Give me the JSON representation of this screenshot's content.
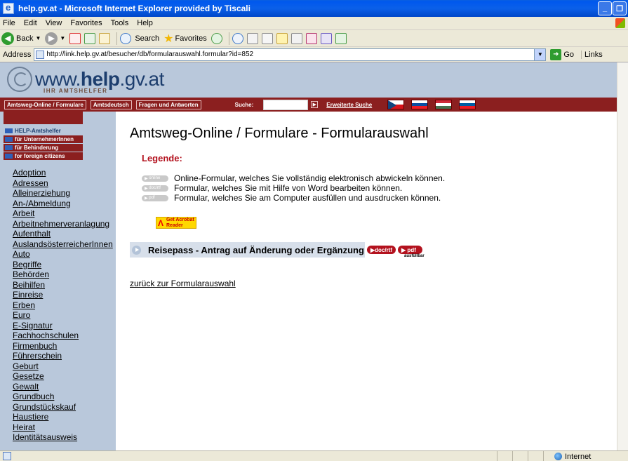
{
  "window": {
    "title": "help.gv.at - Microsoft Internet Explorer provided by Tiscali",
    "buttons": {
      "minimize": "_",
      "restore": "❐"
    }
  },
  "menubar": [
    "File",
    "Edit",
    "View",
    "Favorites",
    "Tools",
    "Help"
  ],
  "toolbar": {
    "back": "Back",
    "search": "Search",
    "favorites": "Favorites"
  },
  "addressbar": {
    "label": "Address",
    "url": "http://link.help.gv.at/besucher/db/formularauswahl.formular?id=852",
    "go": "Go",
    "links": "Links"
  },
  "site": {
    "logo_prefix": "www.",
    "logo_bold": "help",
    "logo_suffix": ".gv.at",
    "logo_tagline": "IHR AMTSHELFER",
    "nav": [
      "Amtsweg-Online / Formulare",
      "Amtsdeutsch",
      "Fragen und Antworten"
    ],
    "search_label": "Suche:",
    "advanced_search": "Erweiterte Suche"
  },
  "sidebar": {
    "menu": [
      "HELP-Amtshelfer",
      "für UnternehmerInnen",
      "für Behinderung",
      "for foreign citizens"
    ],
    "topics": [
      "Adoption",
      "Adressen",
      "Alleinerziehung",
      "An-/Abmeldung",
      "Arbeit",
      "Arbeitnehmerveranlagung",
      "Aufenthalt",
      "AuslandsösterreicherInnen",
      "Auto",
      "Begriffe",
      "Behörden",
      "Beihilfen",
      "Einreise",
      "Erben",
      "Euro",
      "E-Signatur",
      "Fachhochschulen",
      "Firmenbuch",
      "Führerschein",
      "Geburt",
      "Gesetze",
      "Gewalt",
      "Grundbuch",
      "Grundstückskauf",
      "Haustiere",
      "Heirat",
      "Identitätsausweis"
    ]
  },
  "main": {
    "title": "Amtsweg-Online / Formulare - Formularauswahl",
    "legend_title": "Legende:",
    "legend": [
      {
        "pill": "online",
        "text": "Online-Formular, welches Sie vollständig elektronisch abwickeln können."
      },
      {
        "pill": "doc/rtf",
        "text": "Formular, welches Sie mit Hilfe von Word bearbeiten können."
      },
      {
        "pill": "pdf",
        "text": "Formular, welches Sie am Computer ausfüllen und ausdrucken können."
      }
    ],
    "acrobat_line1": "Get Acrobat",
    "acrobat_line2": "Reader",
    "form_name": "Reisepass - Antrag auf Änderung oder Ergänzung",
    "form_doc": "doc/rtf",
    "form_pdf": "pdf",
    "form_pdf_note": "ausfüllbar",
    "back_link": "zurück zur Formularauswahl"
  },
  "statusbar": {
    "zone": "Internet"
  }
}
